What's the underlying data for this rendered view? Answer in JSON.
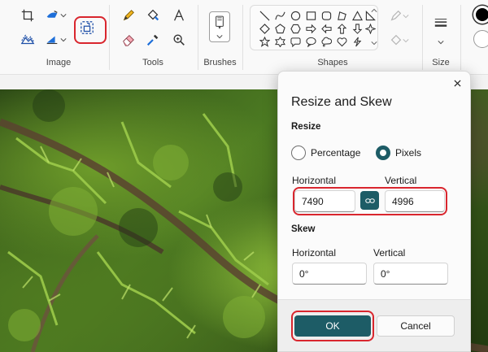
{
  "ribbon": {
    "groups": {
      "image": "Image",
      "tools": "Tools",
      "brushes": "Brushes",
      "shapes": "Shapes",
      "size": "Size"
    },
    "icons": {
      "image": [
        "crop-icon",
        "select-icon",
        "resize-icon",
        "rotate-icon",
        "flip-icon",
        "resize-and-skew-icon"
      ],
      "tools": [
        "pencil-icon",
        "fill-icon",
        "text-icon",
        "eraser-icon",
        "color-picker-icon",
        "magnifier-icon"
      ],
      "shapes": [
        "line",
        "curve",
        "oval",
        "rectangle",
        "rounded-rectangle",
        "polygon",
        "triangle",
        "right-triangle",
        "diamond",
        "pentagon",
        "hexagon",
        "right-arrow",
        "left-arrow",
        "up-arrow",
        "down-arrow",
        "four-point-star",
        "five-point-star",
        "six-point-star",
        "rounded-callout",
        "oval-callout",
        "cloud-callout",
        "heart",
        "lightning"
      ]
    },
    "colors": {
      "primary": "#000000",
      "secondary": "#ffffff"
    }
  },
  "dialog": {
    "title": "Resize and Skew",
    "resize": {
      "section": "Resize",
      "option_percentage": "Percentage",
      "option_pixels": "Pixels",
      "selected": "Pixels",
      "horizontal_label": "Horizontal",
      "vertical_label": "Vertical",
      "horizontal_value": "7490",
      "vertical_value": "4996"
    },
    "skew": {
      "section": "Skew",
      "horizontal_label": "Horizontal",
      "vertical_label": "Vertical",
      "horizontal_value": "0°",
      "vertical_value": "0°"
    },
    "ok_label": "OK",
    "cancel_label": "Cancel"
  },
  "theme": {
    "accent": "#1d5c66",
    "highlight": "#d9262e"
  }
}
